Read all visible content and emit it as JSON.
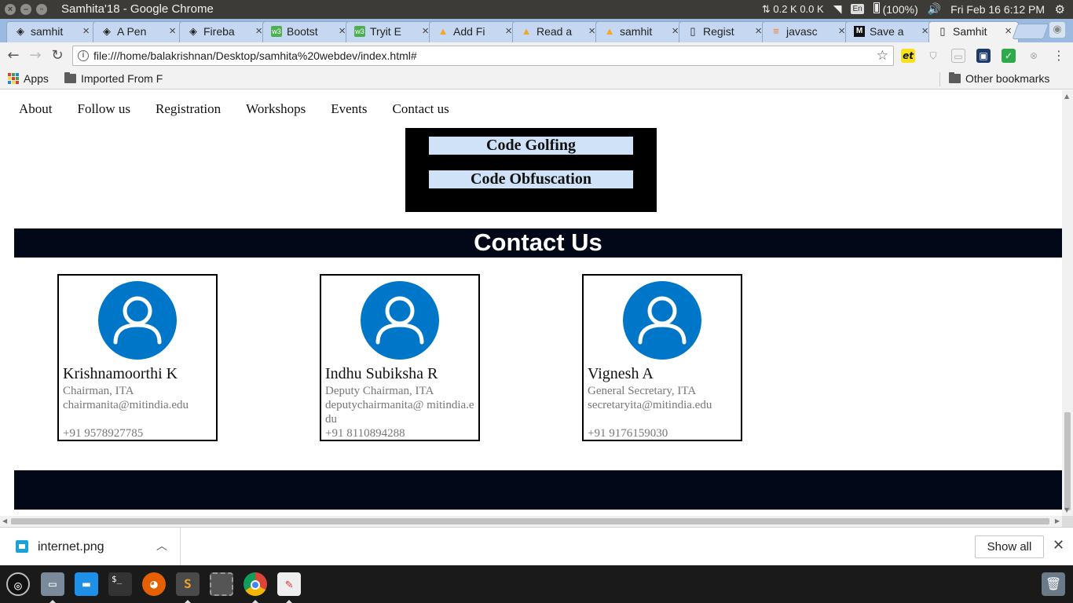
{
  "os_bar": {
    "window_title": "Samhita'18 - Google Chrome",
    "network_speed": "0.2 K 0.0 K",
    "keyboard_layout": "En",
    "battery": "(100%)",
    "clock": "Fri Feb 16  6:12 PM"
  },
  "tabs": [
    {
      "label": "samhit",
      "icon": "codepen-icon"
    },
    {
      "label": "A Pen",
      "icon": "codepen-icon"
    },
    {
      "label": "Fireba",
      "icon": "codepen-icon"
    },
    {
      "label": "Bootst",
      "icon": "w3schools-icon"
    },
    {
      "label": "Tryit E",
      "icon": "w3schools-icon"
    },
    {
      "label": "Add Fi",
      "icon": "firebase-icon"
    },
    {
      "label": "Read a",
      "icon": "firebase-icon"
    },
    {
      "label": "samhit",
      "icon": "firebase-icon"
    },
    {
      "label": "Regist",
      "icon": "document-icon"
    },
    {
      "label": "javasc",
      "icon": "stackoverflow-icon"
    },
    {
      "label": "Save a",
      "icon": "medium-icon"
    },
    {
      "label": "Samhit",
      "icon": "document-icon",
      "active": true
    }
  ],
  "address_bar": {
    "url": "file:///home/balakrishnan/Desktop/samhita%20webdev/index.html#"
  },
  "bookmarks": {
    "apps": "Apps",
    "imported": "Imported From F",
    "other": "Other bookmarks"
  },
  "site_nav": [
    "About",
    "Follow us",
    "Registration",
    "Workshops",
    "Events",
    "Contact us"
  ],
  "events": [
    "Code Golfing",
    "Code Obfuscation"
  ],
  "contact_heading": "Contact Us",
  "contacts": [
    {
      "name": "Krishnamoorthi K",
      "role": "Chairman, ITA",
      "email": "chairmanita@mitindia.edu",
      "phone": "+91 9578927785"
    },
    {
      "name": "Indhu Subiksha R",
      "role": "Deputy Chairman, ITA",
      "email": "deputychairmanita@ mitindia.edu",
      "phone": "+91 8110894288"
    },
    {
      "name": "Vignesh A",
      "role": "General Secretary, ITA",
      "email": "secretaryita@mitindia.edu",
      "phone": "+91 9176159030"
    }
  ],
  "download_bar": {
    "file_name": "internet.png",
    "show_all": "Show all"
  },
  "colors": {
    "dark_band": "#020817",
    "avatar_blue": "#0076c8",
    "event_item_bg": "#cfe2f8"
  }
}
